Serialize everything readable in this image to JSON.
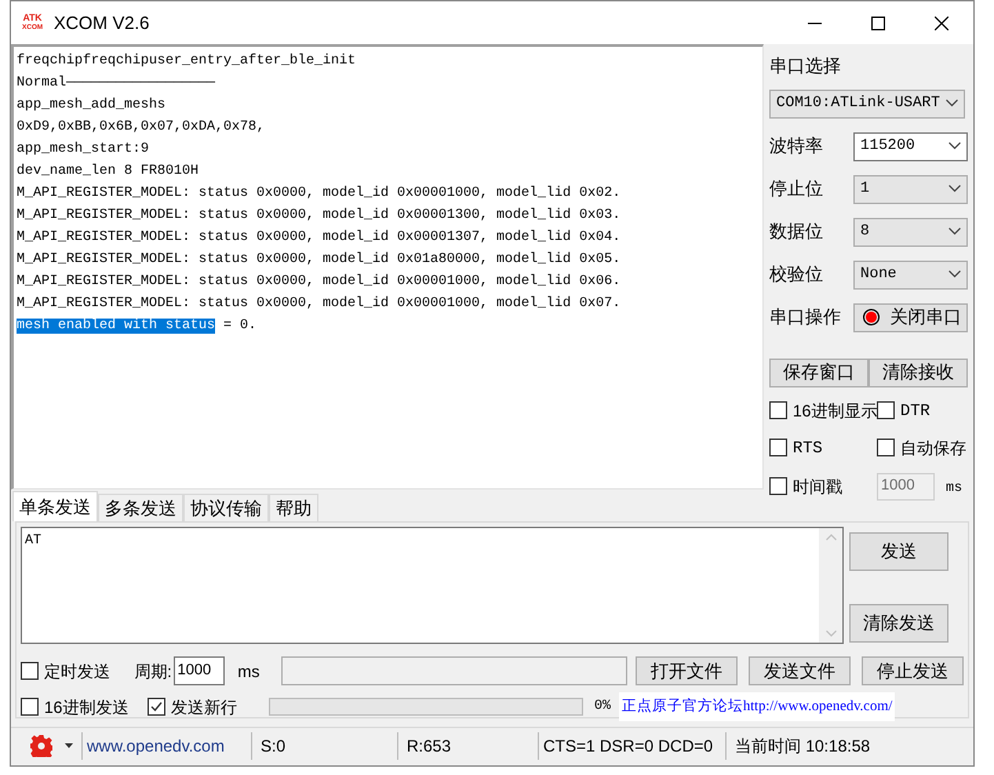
{
  "window": {
    "logo": {
      "line_1": "ATK",
      "line_2": "XCOM"
    },
    "title": "XCOM V2.6"
  },
  "receive_log": {
    "lines": [
      {
        "parts": [
          {
            "text": "freqchipfreqchipuser_entry_after_ble_init",
            "selected": false
          }
        ]
      },
      {
        "parts": [
          {
            "text": "Normal——————————————————",
            "selected": false
          }
        ]
      },
      {
        "parts": [
          {
            "text": "app_mesh_add_meshs",
            "selected": false
          }
        ]
      },
      {
        "parts": [
          {
            "text": "0xD9,0xBB,0x6B,0x07,0xDA,0x78,",
            "selected": false
          }
        ]
      },
      {
        "parts": [
          {
            "text": "app_mesh_start:9",
            "selected": false
          }
        ]
      },
      {
        "parts": [
          {
            "text": "dev_name_len 8 FR8010H",
            "selected": false
          }
        ]
      },
      {
        "parts": [
          {
            "text": "M_API_REGISTER_MODEL: status 0x0000, model_id 0x00001000, model_lid 0x02.",
            "selected": false
          }
        ]
      },
      {
        "parts": [
          {
            "text": "M_API_REGISTER_MODEL: status 0x0000, model_id 0x00001300, model_lid 0x03.",
            "selected": false
          }
        ]
      },
      {
        "parts": [
          {
            "text": "M_API_REGISTER_MODEL: status 0x0000, model_id 0x00001307, model_lid 0x04.",
            "selected": false
          }
        ]
      },
      {
        "parts": [
          {
            "text": "M_API_REGISTER_MODEL: status 0x0000, model_id 0x01a80000, model_lid 0x05.",
            "selected": false
          }
        ]
      },
      {
        "parts": [
          {
            "text": "M_API_REGISTER_MODEL: status 0x0000, model_id 0x00001000, model_lid 0x06.",
            "selected": false
          }
        ]
      },
      {
        "parts": [
          {
            "text": "M_API_REGISTER_MODEL: status 0x0000, model_id 0x00001000, model_lid 0x07.",
            "selected": false
          }
        ]
      },
      {
        "parts": [
          {
            "text": "mesh enabled with status",
            "selected": true
          },
          {
            "text": " = 0.",
            "selected": false
          }
        ]
      }
    ]
  },
  "serial_panel": {
    "port_label": "串口选择",
    "port": "COM10:ATLink-USART",
    "settings": [
      {
        "label": "波特率",
        "value": "115200",
        "editable": true
      },
      {
        "label": "停止位",
        "value": "1",
        "editable": false
      },
      {
        "label": "数据位",
        "value": "8",
        "editable": false
      },
      {
        "label": "校验位",
        "value": "None",
        "editable": false
      }
    ],
    "operation_label": "串口操作",
    "operation_button": "关闭串口",
    "port_open": true,
    "buttons": [
      "保存窗口",
      "清除接收"
    ],
    "options": [
      {
        "label": "16进制显示",
        "checked": false
      },
      {
        "label": "DTR",
        "checked": false
      },
      {
        "label": "RTS",
        "checked": false
      },
      {
        "label": "自动保存",
        "checked": false
      }
    ],
    "timestamp": {
      "label": "时间戳",
      "checked": false,
      "interval": "1000",
      "unit": "ms"
    }
  },
  "send_tabs": [
    {
      "label": "单条发送",
      "selected": true
    },
    {
      "label": "多条发送",
      "selected": false
    },
    {
      "label": "协议传输",
      "selected": false
    },
    {
      "label": "帮助",
      "selected": false
    }
  ],
  "send": {
    "text": "AT",
    "send_button": "发送",
    "clear_button": "清除发送",
    "timed_send": {
      "label": "定时发送",
      "checked": false
    },
    "period_label": "周期:",
    "period": "1000",
    "period_unit": "ms",
    "file_buttons": [
      "打开文件",
      "发送文件",
      "停止发送"
    ],
    "hex_send": {
      "label": "16进制发送",
      "checked": false
    },
    "newline": {
      "label": "发送新行",
      "checked": true
    },
    "progress": {
      "level": 0,
      "reading": "0%"
    },
    "forum_link": "正点原子官方论坛http://www.openedv.com/"
  },
  "status_bar": {
    "website": "www.openedv.com",
    "sent": "S:0",
    "received": "R:653",
    "lines": "CTS=1 DSR=0 DCD=0",
    "time": "当前时间 10:18:58"
  }
}
